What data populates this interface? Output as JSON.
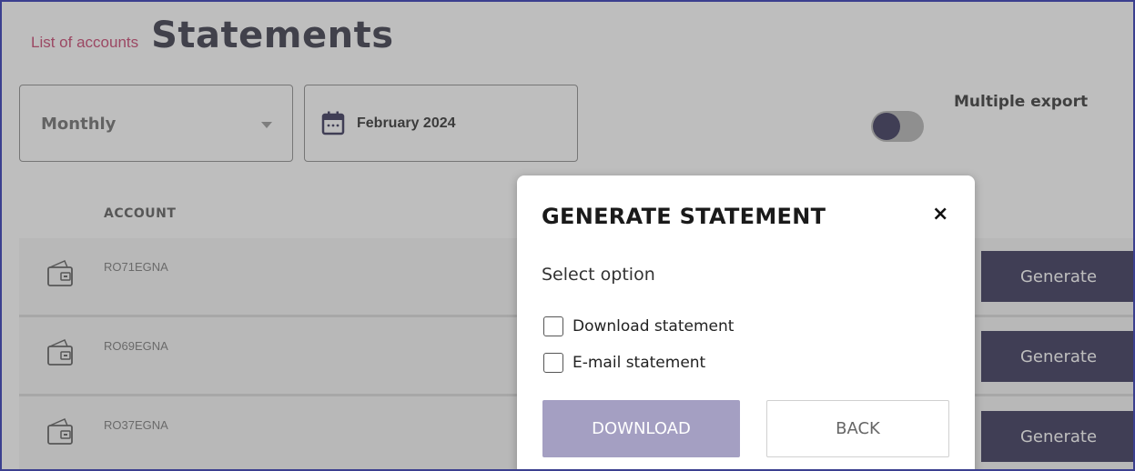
{
  "header": {
    "breadcrumb": "List of accounts",
    "title": "Statements"
  },
  "filters": {
    "period_select_value": "Monthly",
    "date_value": "February 2024"
  },
  "toggle": {
    "label": "Multiple export",
    "state": "off"
  },
  "table": {
    "column_account": "ACCOUNT",
    "rows": [
      {
        "account": "RO71EGNA",
        "button": "Generate"
      },
      {
        "account": "RO69EGNA",
        "button": "Generate"
      },
      {
        "account": "RO37EGNA",
        "button": "Generate"
      }
    ]
  },
  "modal": {
    "title": "GENERATE STATEMENT",
    "close": "×",
    "subtitle": "Select option",
    "options": [
      {
        "label": "Download statement",
        "checked": false
      },
      {
        "label": "E-mail statement",
        "checked": false
      }
    ],
    "primary_button": "DOWNLOAD",
    "secondary_button": "BACK"
  },
  "colors": {
    "brand_dark": "#1a1640",
    "crumb": "#c0285a",
    "download_button": "#a49fc2"
  },
  "icons": {
    "calendar": "calendar-icon",
    "wallet": "wallet-icon",
    "close": "close-icon",
    "caret": "chevron-down-icon"
  }
}
